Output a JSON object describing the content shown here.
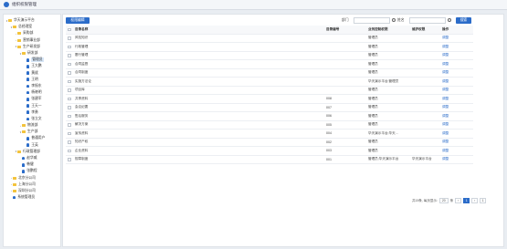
{
  "app": {
    "title": "组织权限管理"
  },
  "sidebar": {
    "tree": [
      {
        "label": "华天演示平台",
        "indent": 0,
        "toggle": "▾",
        "icon": "folder"
      },
      {
        "label": "总经理室",
        "indent": 1,
        "toggle": "▾",
        "icon": "folder"
      },
      {
        "label": "采购部",
        "indent": 2,
        "toggle": "›",
        "icon": "folder"
      },
      {
        "label": "营销事业部",
        "indent": 2,
        "toggle": "›",
        "icon": "folder"
      },
      {
        "label": "生产研发部",
        "indent": 2,
        "toggle": "▾",
        "icon": "folder"
      },
      {
        "label": "研发部",
        "indent": 3,
        "toggle": "▾",
        "icon": "folder"
      },
      {
        "label": "管理员",
        "indent": 4,
        "toggle": "",
        "icon": "person",
        "selected": true
      },
      {
        "label": "王大鹏",
        "indent": 4,
        "toggle": "",
        "icon": "person"
      },
      {
        "label": "黄斌",
        "indent": 4,
        "toggle": "",
        "icon": "person"
      },
      {
        "label": "王明",
        "indent": 4,
        "toggle": "",
        "icon": "person"
      },
      {
        "label": "李振东",
        "indent": 4,
        "toggle": "",
        "icon": "person"
      },
      {
        "label": "杨晓明",
        "indent": 4,
        "toggle": "",
        "icon": "person"
      },
      {
        "label": "张建军",
        "indent": 4,
        "toggle": "",
        "icon": "person"
      },
      {
        "label": "王天一",
        "indent": 4,
        "toggle": "",
        "icon": "person"
      },
      {
        "label": "李勇",
        "indent": 4,
        "toggle": "",
        "icon": "person"
      },
      {
        "label": "张立文",
        "indent": 4,
        "toggle": "",
        "icon": "person"
      },
      {
        "label": "物流部",
        "indent": 3,
        "toggle": "›",
        "icon": "folder"
      },
      {
        "label": "生产部",
        "indent": 3,
        "toggle": "▾",
        "icon": "folder"
      },
      {
        "label": "普通用户",
        "indent": 4,
        "toggle": "",
        "icon": "person"
      },
      {
        "label": "王英",
        "indent": 4,
        "toggle": "",
        "icon": "person"
      },
      {
        "label": "行政管理部",
        "indent": 2,
        "toggle": "▾",
        "icon": "folder"
      },
      {
        "label": "赵华威",
        "indent": 3,
        "toggle": "",
        "icon": "person"
      },
      {
        "label": "韩健",
        "indent": 3,
        "toggle": "",
        "icon": "person"
      },
      {
        "label": "张鹏程",
        "indent": 3,
        "toggle": "",
        "icon": "person"
      },
      {
        "label": "北京分公司",
        "indent": 1,
        "toggle": "›",
        "icon": "folder"
      },
      {
        "label": "上海分公司",
        "indent": 1,
        "toggle": "›",
        "icon": "folder"
      },
      {
        "label": "深圳分公司",
        "indent": 1,
        "toggle": "›",
        "icon": "folder"
      },
      {
        "label": "系统管理员",
        "indent": 1,
        "toggle": "",
        "icon": "person"
      }
    ]
  },
  "toolbar": {
    "add_label": "权限编辑",
    "dept_label": "部门",
    "name_label": "姓名",
    "search_label": "搜索"
  },
  "table": {
    "headers": [
      "目录名称",
      "目录编号",
      "业务控制权限",
      "维护权限",
      "操作"
    ],
    "rows": [
      {
        "name": "风险知识",
        "code": "",
        "control": "管理员",
        "maintain": "",
        "action": "调整"
      },
      {
        "name": "行政管理",
        "code": "",
        "control": "管理员",
        "maintain": "",
        "action": "调整"
      },
      {
        "name": "履行管理",
        "code": "",
        "control": "管理员",
        "maintain": "",
        "action": "调整"
      },
      {
        "name": "合同监督",
        "code": "",
        "control": "管理员",
        "maintain": "",
        "action": "调整"
      },
      {
        "name": "合同制度",
        "code": "",
        "control": "管理员",
        "maintain": "",
        "action": "调整"
      },
      {
        "name": "实施方法论",
        "code": "",
        "control": "华天演示平台;管理员",
        "maintain": "",
        "action": "调整"
      },
      {
        "name": "项目库",
        "code": "",
        "control": "管理员",
        "maintain": "",
        "action": "调整"
      },
      {
        "name": "共享资料",
        "code": "008",
        "control": "管理员",
        "maintain": "",
        "action": "调整"
      },
      {
        "name": "会议纪要",
        "code": "007",
        "control": "管理员",
        "maintain": "",
        "action": "调整"
      },
      {
        "name": "售后服务",
        "code": "006",
        "control": "管理员",
        "maintain": "",
        "action": "调整"
      },
      {
        "name": "解决方案",
        "code": "005",
        "control": "管理员",
        "maintain": "",
        "action": "调整"
      },
      {
        "name": "宣传资料",
        "code": "004",
        "control": "华天演示平台;华天...",
        "maintain": "",
        "action": "调整"
      },
      {
        "name": "知识产权",
        "code": "002",
        "control": "管理员",
        "maintain": "",
        "action": "调整"
      },
      {
        "name": "企业资料",
        "code": "003",
        "control": "管理员",
        "maintain": "",
        "action": "调整"
      },
      {
        "name": "规章制度",
        "code": "001",
        "control": "管理员;华天演示平台",
        "maintain": "华天演示平台",
        "action": "调整"
      }
    ]
  },
  "pager": {
    "summary": "共15条, 每页显示:",
    "page_size": "20",
    "unit": "条",
    "current_page": "1",
    "go_label": "1"
  }
}
